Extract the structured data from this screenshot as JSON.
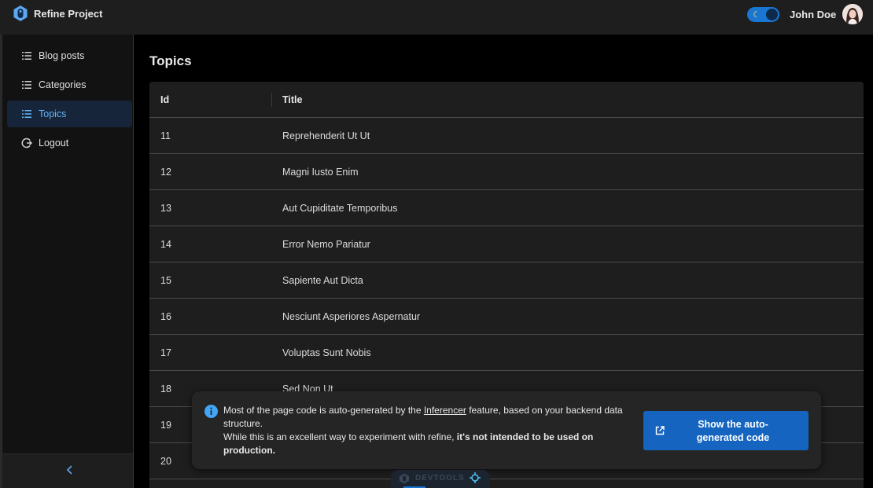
{
  "header": {
    "brand_name": "Refine Project",
    "user_name": "John Doe",
    "theme_icon": "moon-icon"
  },
  "sidebar": {
    "items": [
      {
        "label": "Blog posts",
        "icon": "list-icon",
        "active": false
      },
      {
        "label": "Categories",
        "icon": "list-icon",
        "active": false
      },
      {
        "label": "Topics",
        "icon": "list-icon",
        "active": true
      },
      {
        "label": "Logout",
        "icon": "logout-icon",
        "active": false
      }
    ],
    "collapse_icon": "chevron-left-icon"
  },
  "main": {
    "page_title": "Topics",
    "table": {
      "columns": [
        "Id",
        "Title"
      ],
      "rows": [
        {
          "id": "11",
          "title": "Reprehenderit Ut Ut"
        },
        {
          "id": "12",
          "title": "Magni Iusto Enim"
        },
        {
          "id": "13",
          "title": "Aut Cupiditate Temporibus"
        },
        {
          "id": "14",
          "title": "Error Nemo Pariatur"
        },
        {
          "id": "15",
          "title": "Sapiente Aut Dicta"
        },
        {
          "id": "16",
          "title": "Nesciunt Asperiores Aspernatur"
        },
        {
          "id": "17",
          "title": "Voluptas Sunt Nobis"
        },
        {
          "id": "18",
          "title": "Sed Non Ut"
        },
        {
          "id": "19",
          "title": ""
        },
        {
          "id": "20",
          "title": ""
        }
      ]
    }
  },
  "toast": {
    "text_1": "Most of the page code is auto-generated by the ",
    "link": "Inferencer",
    "text_2": " feature, based on your backend data structure.",
    "text_3": "While this is an excellent way to experiment with refine, ",
    "bold": "it's not intended to be used on production.",
    "button_label": "Show the auto-generated code",
    "info_icon": "info-icon",
    "button_icon": "external-link-icon"
  },
  "devtools": {
    "label": "DEVTOOLS"
  },
  "colors": {
    "accent": "#1976d2",
    "active_text": "#64b5f6",
    "button": "#1565c0",
    "header_bg": "#1e1e1e",
    "page_bg": "#000000"
  }
}
